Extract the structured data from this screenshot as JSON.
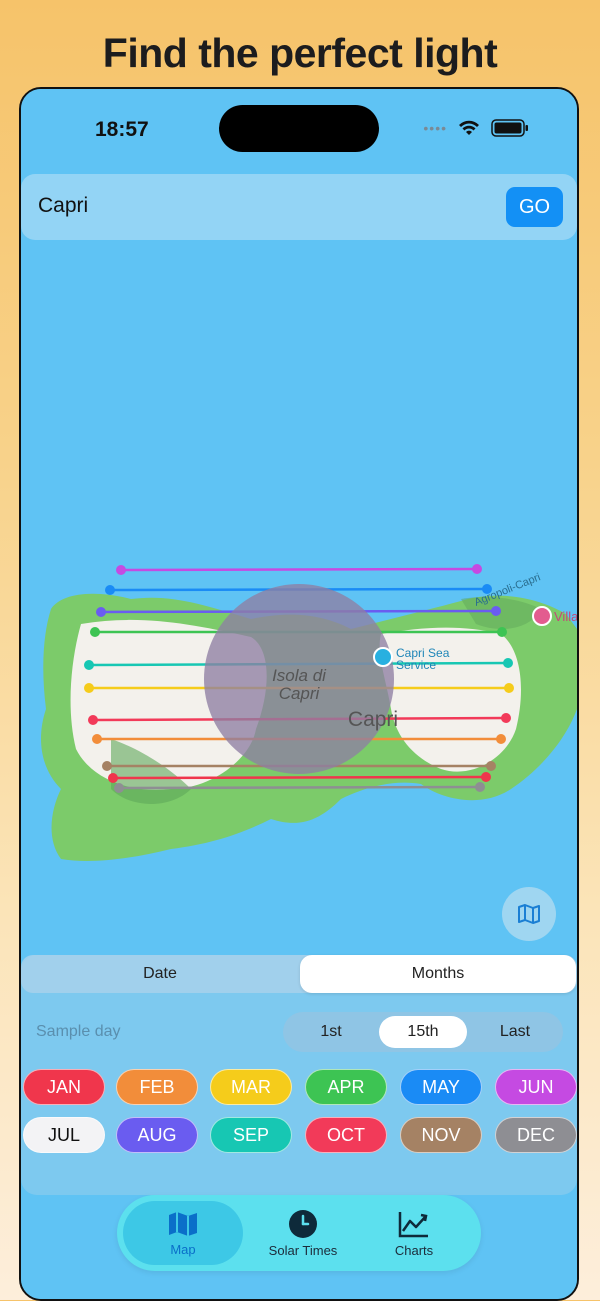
{
  "headline": "Find the perfect light",
  "status": {
    "time": "18:57"
  },
  "search": {
    "value": "Capri",
    "go_label": "GO"
  },
  "map": {
    "labels": {
      "island": [
        "Isola di",
        "Capri"
      ],
      "town": "Capri",
      "poi": [
        "Capri Sea",
        "Service"
      ],
      "road": "Agropoli-Capri",
      "villa": "Villa"
    }
  },
  "panel": {
    "modes": [
      "Date",
      "Months"
    ],
    "selected_mode": "Months",
    "sample_day_label": "Sample day",
    "sample_days": [
      "1st",
      "15th",
      "Last"
    ],
    "selected_day": "15th",
    "months_row1": [
      {
        "label": "JAN",
        "color": "#f0364c"
      },
      {
        "label": "FEB",
        "color": "#f28d3a"
      },
      {
        "label": "MAR",
        "color": "#f5cc1b"
      },
      {
        "label": "APR",
        "color": "#3dc453"
      },
      {
        "label": "MAY",
        "color": "#1a8bf5"
      },
      {
        "label": "JUN",
        "color": "#c54ae2"
      }
    ],
    "months_row2": [
      {
        "label": "JUL",
        "color": "#f3f3f5",
        "text_color": "#111"
      },
      {
        "label": "AUG",
        "color": "#6a5cf0"
      },
      {
        "label": "SEP",
        "color": "#17c7b3"
      },
      {
        "label": "OCT",
        "color": "#f23a59"
      },
      {
        "label": "NOV",
        "color": "#a58264"
      },
      {
        "label": "DEC",
        "color": "#8e8e93"
      }
    ]
  },
  "tabs": [
    {
      "label": "Map",
      "icon": "map-icon"
    },
    {
      "label": "Solar Times",
      "icon": "clock-icon"
    },
    {
      "label": "Charts",
      "icon": "chart-icon"
    }
  ]
}
